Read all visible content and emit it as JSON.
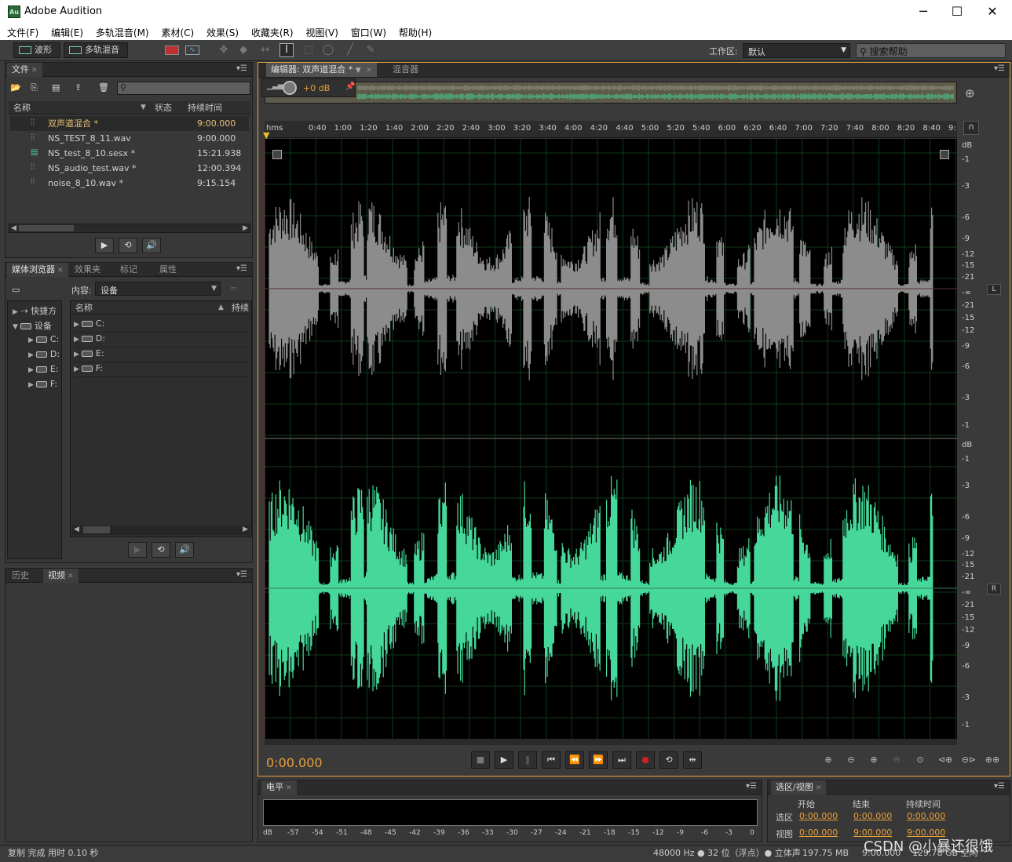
{
  "window": {
    "app_title": "Adobe Audition",
    "logo_text": "Au"
  },
  "menu": [
    "文件(F)",
    "编辑(E)",
    "多轨混音(M)",
    "素材(C)",
    "效果(S)",
    "收藏夹(R)",
    "视图(V)",
    "窗口(W)",
    "帮助(H)"
  ],
  "toolbar": {
    "waveform_label": "波形",
    "multitrack_label": "多轨混音",
    "workspace_label": "工作区:",
    "workspace_value": "默认",
    "search_placeholder": "搜索帮助"
  },
  "files_panel": {
    "tab": "文件",
    "columns": {
      "name": "名称",
      "status": "状态",
      "duration": "持续时间"
    },
    "rows": [
      {
        "name": "双声道混合 *",
        "duration": "9:00.000",
        "icon": "waveform-icon",
        "selected": true
      },
      {
        "name": "NS_TEST_8_11.wav",
        "duration": "9:00.000",
        "icon": "waveform-icon"
      },
      {
        "name": "NS_test_8_10.sesx *",
        "duration": "15:21.938",
        "icon": "multitrack-icon"
      },
      {
        "name": "NS_audio_test.wav *",
        "duration": "12:00.394",
        "icon": "waveform-icon"
      },
      {
        "name": "noise_8_10.wav *",
        "duration": "9:15.154",
        "icon": "waveform-icon"
      }
    ]
  },
  "media_panel": {
    "tabs": [
      "媒体浏览器",
      "效果夹",
      "标记",
      "属性"
    ],
    "content_label": "内容:",
    "content_value": "设备",
    "tree": {
      "shortcuts": "快捷方",
      "devices": "设备",
      "drives": [
        "C:",
        "D:",
        "E:",
        "F:"
      ]
    },
    "list_columns": {
      "name": "名称",
      "duration": "持续"
    },
    "list_items": [
      "C:",
      "D:",
      "E:",
      "F:"
    ]
  },
  "history_panel": {
    "tabs": [
      "历史",
      "视频"
    ]
  },
  "editor": {
    "tab": "编辑器: 双声道混合 *",
    "mixer_tab": "混音器",
    "gain": "+0 dB",
    "ruler_labels": [
      "hms",
      "0:40",
      "1:00",
      "1:20",
      "1:40",
      "2:00",
      "2:20",
      "2:40",
      "3:00",
      "3:20",
      "3:40",
      "4:00",
      "4:20",
      "4:40",
      "5:00",
      "5:20",
      "5:40",
      "6:00",
      "6:20",
      "6:40",
      "7:00",
      "7:20",
      "7:40",
      "8:00",
      "8:20",
      "8:40",
      "9:"
    ],
    "db_scale": [
      "dB",
      "-1",
      "-3",
      "-6",
      "-9",
      "-12",
      "-15",
      "-21",
      "-∞",
      "-21",
      "-15",
      "-12",
      "-9",
      "-6",
      "-3",
      "-1"
    ],
    "channel_left": "L",
    "channel_right": "R",
    "timecode": "0:00.000",
    "colors": {
      "left_wave": "#8c8c8c",
      "right_wave": "#45d89a",
      "accent": "#e8a03a"
    }
  },
  "meter_panel": {
    "tab": "电平",
    "scale": [
      "dB",
      "-57",
      "-54",
      "-51",
      "-48",
      "-45",
      "-42",
      "-39",
      "-36",
      "-33",
      "-30",
      "-27",
      "-24",
      "-21",
      "-18",
      "-15",
      "-12",
      "-9",
      "-6",
      "-3",
      "0"
    ]
  },
  "selection_panel": {
    "tab": "选区/视图",
    "columns": {
      "start": "开始",
      "end": "结束",
      "duration": "持续时间"
    },
    "selection": {
      "label": "选区",
      "start": "0:00.000",
      "end": "0:00.000",
      "duration": "0:00.000"
    },
    "view": {
      "label": "视图",
      "start": "0:00.000",
      "end": "9:00.000",
      "duration": "9:00.000"
    }
  },
  "status_bar": {
    "message": "复制 完成 用时 0.10 秒",
    "format": "48000 Hz ● 32 位（浮点）● 立体声",
    "size1": "197.75 MB",
    "time": "9:00.000",
    "size2": "129.78 GB 空闲"
  },
  "watermark": "CSDN @小暴还很饿"
}
